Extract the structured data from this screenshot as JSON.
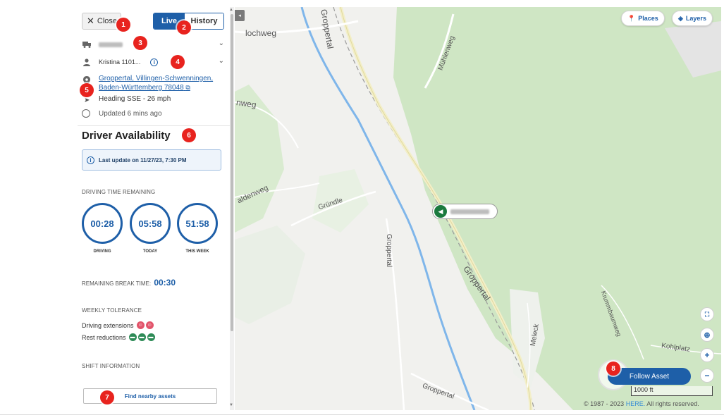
{
  "panel": {
    "close_label": "Close",
    "tabs": {
      "live": "Live",
      "history": "History"
    },
    "driver_name": "Kristina 1101...",
    "address": "Groppertal, Villingen-Schwenningen, Baden-Württemberg 78048",
    "heading": "Heading SSE - 26 mph",
    "updated": "Updated 6 mins ago"
  },
  "availability": {
    "title": "Driver Availability",
    "last_update": "Last update on 11/27/23, 7:30 PM",
    "driving_time_label": "DRIVING TIME REMAINING",
    "timers": [
      {
        "value": "00:28",
        "label": "DRIVING"
      },
      {
        "value": "05:58",
        "label": "TODAY"
      },
      {
        "value": "51:58",
        "label": "THIS WEEK"
      }
    ],
    "break_label": "REMAINING BREAK TIME:",
    "break_value": "00:30",
    "weekly_tolerance_label": "WEEKLY TOLERANCE",
    "driving_extensions_label": "Driving extensions",
    "rest_reductions_label": "Rest reductions",
    "shift_info_label": "SHIFT INFORMATION",
    "find_nearby_label": "Find nearby assets"
  },
  "map": {
    "places_label": "Places",
    "layers_label": "Layers",
    "follow_label": "Follow Asset",
    "scale_label": "1000 ft",
    "copyright_prefix": "© 1987 - 2023",
    "copyright_brand": "HERE.",
    "copyright_suffix": "All rights reserved.",
    "roads": {
      "lochweg": "lochweg",
      "mublenweg": "Mühlenweg",
      "nweg": "nweg",
      "aldenweg": "aldenweg",
      "grundle": "Gründle",
      "groppertal_top": "Groppertal",
      "groppertal_mid": "Groppertal",
      "groppertal_main": "Groppertal",
      "groppertal_bottom": "Groppertal",
      "meleck": "Meleck",
      "krummbaumweg": "Krummbaumweg",
      "kohlplatz": "Kohlplatz"
    }
  },
  "badges": [
    "1",
    "2",
    "3",
    "4",
    "5",
    "6",
    "7",
    "8"
  ],
  "colors": {
    "accent": "#1e5fa8",
    "badge": "#e8231e",
    "forest": "#cfe6c4",
    "river": "#7fb6ea"
  }
}
